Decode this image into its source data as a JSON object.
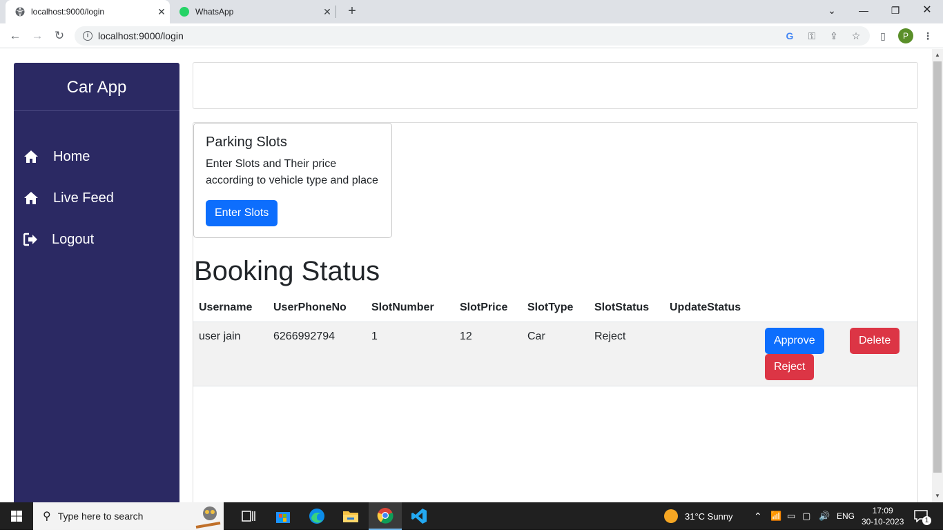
{
  "browser": {
    "tabs": [
      {
        "title": "localhost:9000/login",
        "active": true
      },
      {
        "title": "WhatsApp",
        "active": false
      }
    ],
    "url": "localhost:9000/login",
    "profile_initial": "P"
  },
  "sidebar": {
    "brand": "Car App",
    "items": [
      {
        "label": "Home",
        "icon": "home-icon"
      },
      {
        "label": "Live Feed",
        "icon": "home-icon"
      },
      {
        "label": "Logout",
        "icon": "logout-icon"
      }
    ]
  },
  "card": {
    "title": "Parking Slots",
    "text": "Enter Slots and Their price according to vehicle type and place",
    "button": "Enter Slots"
  },
  "booking": {
    "heading": "Booking Status",
    "columns": [
      "Username",
      "UserPhoneNo",
      "SlotNumber",
      "SlotPrice",
      "SlotType",
      "SlotStatus",
      "UpdateStatus"
    ],
    "rows": [
      {
        "username": "user jain",
        "phone": "6266992794",
        "slot_number": "1",
        "slot_price": "12",
        "slot_type": "Car",
        "slot_status": "Reject"
      }
    ],
    "actions": {
      "approve": "Approve",
      "reject": "Reject",
      "delete": "Delete"
    }
  },
  "taskbar": {
    "search_placeholder": "Type here to search",
    "weather": "31°C  Sunny",
    "language": "ENG",
    "time": "17:09",
    "date": "30-10-2023",
    "notification_count": "1"
  },
  "colors": {
    "sidebar": "#2b2963",
    "primary": "#0d6efd",
    "danger": "#dc3545"
  }
}
